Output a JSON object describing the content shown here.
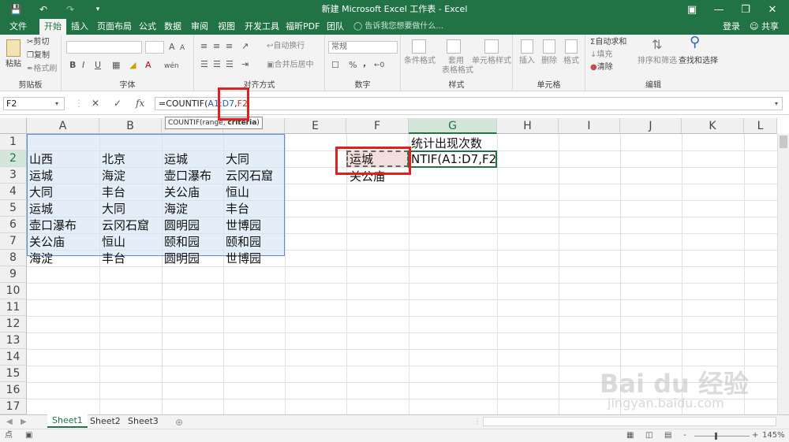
{
  "window": {
    "title": "新建 Microsoft Excel 工作表 - Excel",
    "login": "登录",
    "share": "共享"
  },
  "ribbon_tabs": [
    "文件",
    "开始",
    "插入",
    "页面布局",
    "公式",
    "数据",
    "审阅",
    "视图",
    "开发工具",
    "福昕PDF",
    "团队"
  ],
  "active_tab": "开始",
  "tell_me": "告诉我您想要做什么...",
  "ribbon": {
    "clipboard": {
      "label": "剪贴板",
      "paste": "粘贴",
      "cut": "剪切",
      "copy": "复制",
      "format_painter": "格式刷"
    },
    "font": {
      "label": "字体",
      "bold": "B",
      "italic": "I",
      "underline": "U",
      "size_up": "A",
      "size_down": "A",
      "font_color": "A",
      "phonetic": "wén"
    },
    "alignment": {
      "label": "对齐方式",
      "wrap": "自动换行",
      "merge": "合并后居中"
    },
    "number": {
      "label": "数字",
      "format": "常规",
      "percent": "%",
      "comma": ","
    },
    "styles": {
      "label": "样式",
      "conditional": "条件格式",
      "table": "套用",
      "table2": "表格格式",
      "cell_styles": "单元格样式"
    },
    "cells": {
      "label": "单元格",
      "insert": "插入",
      "delete": "删除",
      "format": "格式"
    },
    "editing": {
      "label": "编辑",
      "autosum": "自动求和",
      "fill": "填充",
      "clear": "清除",
      "sort": "排序和筛选",
      "find": "查找和选择"
    }
  },
  "formula_bar": {
    "name_box": "F2",
    "formula_prefix": "=COUNTIF(",
    "formula_range": "A1:D7",
    "formula_sep": ",",
    "formula_arg": "F2",
    "tooltip_fn": "COUNTIF(range, ",
    "tooltip_bold": "criteria",
    "tooltip_end": ")"
  },
  "columns": [
    "A",
    "B",
    "C",
    "D",
    "E",
    "F",
    "G",
    "H",
    "I",
    "J",
    "K",
    "L"
  ],
  "rows": [
    "1",
    "2",
    "3",
    "4",
    "5",
    "6",
    "7",
    "8",
    "9",
    "10",
    "11",
    "12",
    "13",
    "14",
    "15",
    "16",
    "17"
  ],
  "cells": {
    "A": [
      "山西",
      "运城",
      "大同",
      "运城",
      "壶口瀑布",
      "关公庙",
      "海淀"
    ],
    "B": [
      "北京",
      "海淀",
      "丰台",
      "大同",
      "云冈石窟",
      "恒山",
      "丰台"
    ],
    "C": [
      "运城",
      "壶口瀑布",
      "关公庙",
      "海淀",
      "圆明园",
      "颐和园",
      "圆明园"
    ],
    "D": [
      "大同",
      "云冈石窟",
      "恒山",
      "丰台",
      "世博园",
      "颐和园",
      "世博园"
    ],
    "F2": "运城",
    "F3": "关公庙",
    "G1": "统计出现次数",
    "G2": "NTIF(A1:D7,F2"
  },
  "sheets": [
    "Sheet1",
    "Sheet2",
    "Sheet3"
  ],
  "active_sheet": "Sheet1",
  "status": {
    "mode": "点",
    "zoom": "145%",
    "minus": "-",
    "plus": "+"
  },
  "watermark": "Bai du 经验 jingyan.baidu.com",
  "colors": {
    "excel_green": "#217346",
    "highlight": "#e0201e",
    "selection_fill": "#d2e2f4"
  }
}
